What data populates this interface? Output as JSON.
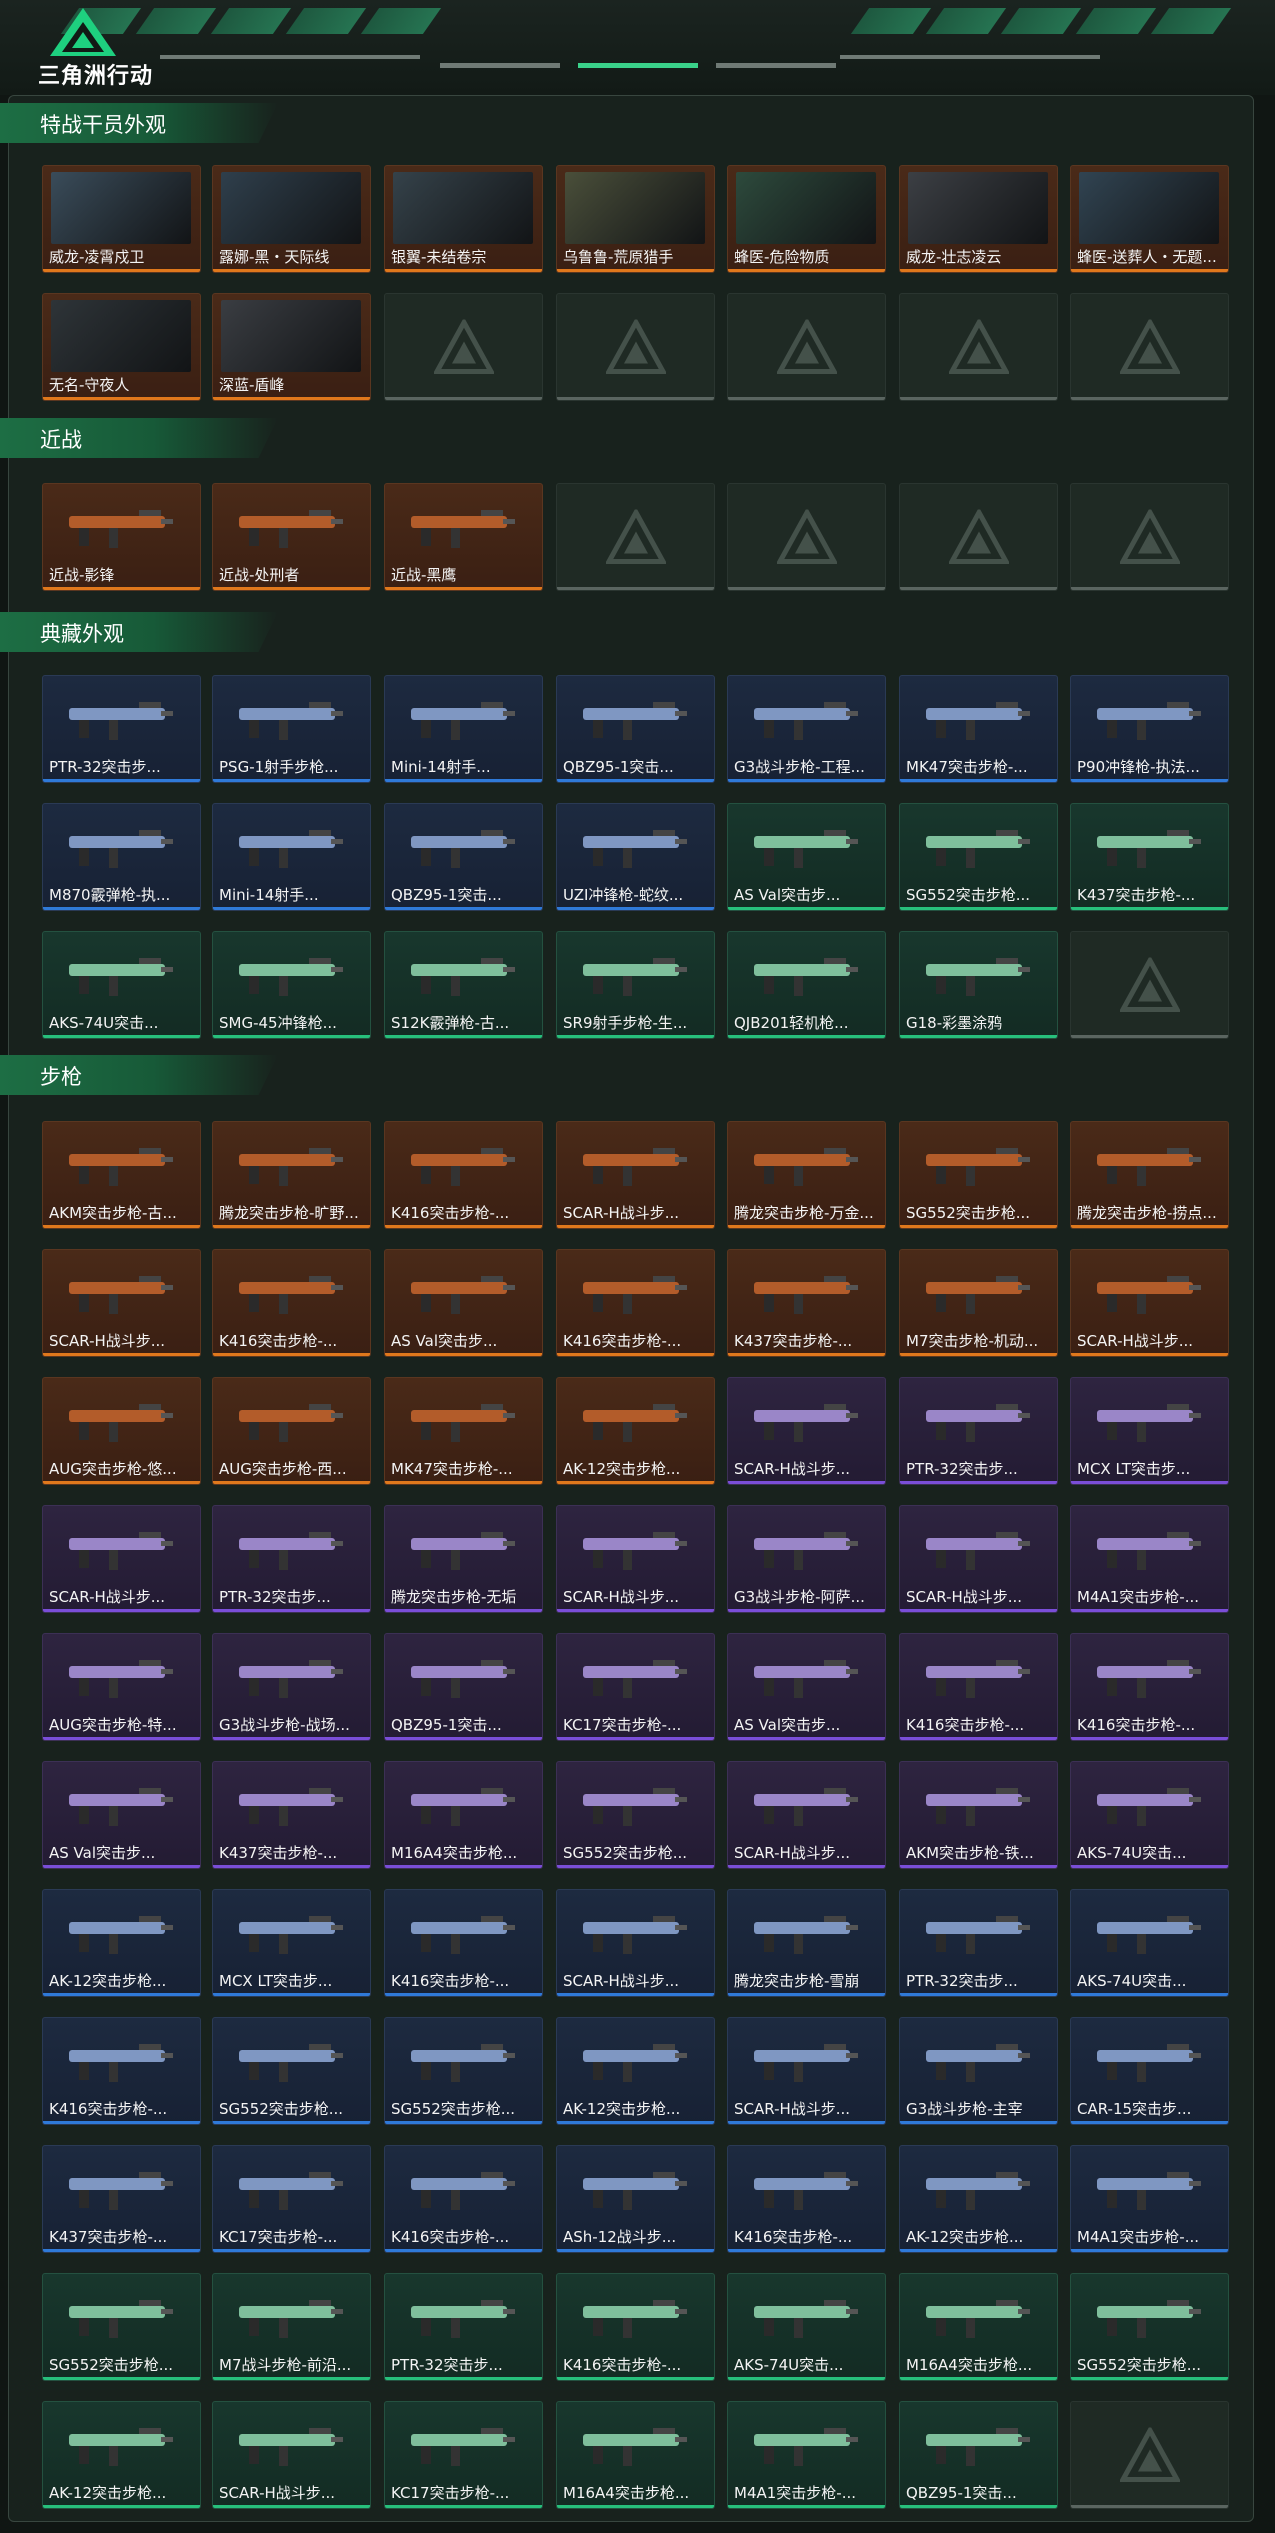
{
  "app": {
    "title": "三角洲行动"
  },
  "colors": {
    "legendary": "#e0781c",
    "epic": "#7a4ed8",
    "rare": "#2f7ad9",
    "uncommon": "#27c07c",
    "empty": "#5a6560"
  },
  "sections": [
    {
      "title": "特战干员外观",
      "items": [
        {
          "label": "威龙-凌霄戍卫",
          "rarity": "gold"
        },
        {
          "label": "露娜-黑・天际线",
          "rarity": "gold"
        },
        {
          "label": "银翼-未结卷宗",
          "rarity": "gold"
        },
        {
          "label": "乌鲁鲁-荒原猎手",
          "rarity": "gold"
        },
        {
          "label": "蜂医-危险物质",
          "rarity": "gold"
        },
        {
          "label": "威龙-壮志凌云",
          "rarity": "gold"
        },
        {
          "label": "蜂医-送葬人・无题...",
          "rarity": "gold"
        },
        {
          "label": "无名-守夜人",
          "rarity": "gold"
        },
        {
          "label": "深蓝-盾峰",
          "rarity": "gold"
        },
        {
          "label": "",
          "rarity": "empty"
        },
        {
          "label": "",
          "rarity": "empty"
        },
        {
          "label": "",
          "rarity": "empty"
        },
        {
          "label": "",
          "rarity": "empty"
        },
        {
          "label": "",
          "rarity": "empty"
        }
      ]
    },
    {
      "title": "近战",
      "items": [
        {
          "label": "近战-影锋",
          "rarity": "gold"
        },
        {
          "label": "近战-处刑者",
          "rarity": "gold"
        },
        {
          "label": "近战-黑鹰",
          "rarity": "gold"
        },
        {
          "label": "",
          "rarity": "empty"
        },
        {
          "label": "",
          "rarity": "empty"
        },
        {
          "label": "",
          "rarity": "empty"
        },
        {
          "label": "",
          "rarity": "empty"
        }
      ]
    },
    {
      "title": "典藏外观",
      "items": [
        {
          "label": "PTR-32突击步...",
          "rarity": "blue"
        },
        {
          "label": "PSG-1射手步枪...",
          "rarity": "blue"
        },
        {
          "label": "Mini-14射手...",
          "rarity": "blue"
        },
        {
          "label": "QBZ95-1突击...",
          "rarity": "blue"
        },
        {
          "label": "G3战斗步枪-工程...",
          "rarity": "blue"
        },
        {
          "label": "MK47突击步枪-...",
          "rarity": "blue"
        },
        {
          "label": "P90冲锋枪-执法...",
          "rarity": "blue"
        },
        {
          "label": "M870霰弹枪-执...",
          "rarity": "blue"
        },
        {
          "label": "Mini-14射手...",
          "rarity": "blue"
        },
        {
          "label": "QBZ95-1突击...",
          "rarity": "blue"
        },
        {
          "label": "UZI冲锋枪-蛇纹...",
          "rarity": "blue"
        },
        {
          "label": "AS Val突击步...",
          "rarity": "green"
        },
        {
          "label": "SG552突击步枪...",
          "rarity": "green"
        },
        {
          "label": "K437突击步枪-...",
          "rarity": "green"
        },
        {
          "label": "AKS-74U突击...",
          "rarity": "green"
        },
        {
          "label": "SMG-45冲锋枪...",
          "rarity": "green"
        },
        {
          "label": "S12K霰弹枪-古...",
          "rarity": "green"
        },
        {
          "label": "SR9射手步枪-生...",
          "rarity": "green"
        },
        {
          "label": "QJB201轻机枪...",
          "rarity": "green"
        },
        {
          "label": "G18-彩墨涂鸦",
          "rarity": "green"
        },
        {
          "label": "",
          "rarity": "empty"
        }
      ]
    },
    {
      "title": "步枪",
      "items": [
        {
          "label": "AKM突击步枪-古...",
          "rarity": "gold"
        },
        {
          "label": "腾龙突击步枪-旷野...",
          "rarity": "gold"
        },
        {
          "label": "K416突击步枪-...",
          "rarity": "gold"
        },
        {
          "label": "SCAR-H战斗步...",
          "rarity": "gold"
        },
        {
          "label": "腾龙突击步枪-万金...",
          "rarity": "gold"
        },
        {
          "label": "SG552突击步枪...",
          "rarity": "gold"
        },
        {
          "label": "腾龙突击步枪-捞点...",
          "rarity": "gold"
        },
        {
          "label": "SCAR-H战斗步...",
          "rarity": "gold"
        },
        {
          "label": "K416突击步枪-...",
          "rarity": "gold"
        },
        {
          "label": "AS Val突击步...",
          "rarity": "gold"
        },
        {
          "label": "K416突击步枪-...",
          "rarity": "gold"
        },
        {
          "label": "K437突击步枪-...",
          "rarity": "gold"
        },
        {
          "label": "M7突击步枪-机动...",
          "rarity": "gold"
        },
        {
          "label": "SCAR-H战斗步...",
          "rarity": "gold"
        },
        {
          "label": "AUG突击步枪-悠...",
          "rarity": "gold"
        },
        {
          "label": "AUG突击步枪-西...",
          "rarity": "gold"
        },
        {
          "label": "MK47突击步枪-...",
          "rarity": "gold"
        },
        {
          "label": "AK-12突击步枪...",
          "rarity": "gold"
        },
        {
          "label": "SCAR-H战斗步...",
          "rarity": "purple"
        },
        {
          "label": "PTR-32突击步...",
          "rarity": "purple"
        },
        {
          "label": "MCX LT突击步...",
          "rarity": "purple"
        },
        {
          "label": "SCAR-H战斗步...",
          "rarity": "purple"
        },
        {
          "label": "PTR-32突击步...",
          "rarity": "purple"
        },
        {
          "label": "腾龙突击步枪-无垢",
          "rarity": "purple"
        },
        {
          "label": "SCAR-H战斗步...",
          "rarity": "purple"
        },
        {
          "label": "G3战斗步枪-阿萨...",
          "rarity": "purple"
        },
        {
          "label": "SCAR-H战斗步...",
          "rarity": "purple"
        },
        {
          "label": "M4A1突击步枪-...",
          "rarity": "purple"
        },
        {
          "label": "AUG突击步枪-特...",
          "rarity": "purple"
        },
        {
          "label": "G3战斗步枪-战场...",
          "rarity": "purple"
        },
        {
          "label": "QBZ95-1突击...",
          "rarity": "purple"
        },
        {
          "label": "KC17突击步枪-...",
          "rarity": "purple"
        },
        {
          "label": "AS Val突击步...",
          "rarity": "purple"
        },
        {
          "label": "K416突击步枪-...",
          "rarity": "purple"
        },
        {
          "label": "K416突击步枪-...",
          "rarity": "purple"
        },
        {
          "label": "AS Val突击步...",
          "rarity": "purple"
        },
        {
          "label": "K437突击步枪-...",
          "rarity": "purple"
        },
        {
          "label": "M16A4突击步枪...",
          "rarity": "purple"
        },
        {
          "label": "SG552突击步枪...",
          "rarity": "purple"
        },
        {
          "label": "SCAR-H战斗步...",
          "rarity": "purple"
        },
        {
          "label": "AKM突击步枪-铁...",
          "rarity": "purple"
        },
        {
          "label": "AKS-74U突击...",
          "rarity": "purple"
        },
        {
          "label": "AK-12突击步枪...",
          "rarity": "blue"
        },
        {
          "label": "MCX LT突击步...",
          "rarity": "blue"
        },
        {
          "label": "K416突击步枪-...",
          "rarity": "blue"
        },
        {
          "label": "SCAR-H战斗步...",
          "rarity": "blue"
        },
        {
          "label": "腾龙突击步枪-雪崩",
          "rarity": "blue"
        },
        {
          "label": "PTR-32突击步...",
          "rarity": "blue"
        },
        {
          "label": "AKS-74U突击...",
          "rarity": "blue"
        },
        {
          "label": "K416突击步枪-...",
          "rarity": "blue"
        },
        {
          "label": "SG552突击步枪...",
          "rarity": "blue"
        },
        {
          "label": "SG552突击步枪...",
          "rarity": "blue"
        },
        {
          "label": "AK-12突击步枪...",
          "rarity": "blue"
        },
        {
          "label": "SCAR-H战斗步...",
          "rarity": "blue"
        },
        {
          "label": "G3战斗步枪-主宰",
          "rarity": "blue"
        },
        {
          "label": "CAR-15突击步...",
          "rarity": "blue"
        },
        {
          "label": "K437突击步枪-...",
          "rarity": "blue"
        },
        {
          "label": "KC17突击步枪-...",
          "rarity": "blue"
        },
        {
          "label": "K416突击步枪-...",
          "rarity": "blue"
        },
        {
          "label": "ASh-12战斗步...",
          "rarity": "blue"
        },
        {
          "label": "K416突击步枪-...",
          "rarity": "blue"
        },
        {
          "label": "AK-12突击步枪...",
          "rarity": "blue"
        },
        {
          "label": "M4A1突击步枪-...",
          "rarity": "blue"
        },
        {
          "label": "SG552突击步枪...",
          "rarity": "green"
        },
        {
          "label": "M7战斗步枪-前沿...",
          "rarity": "green"
        },
        {
          "label": "PTR-32突击步...",
          "rarity": "green"
        },
        {
          "label": "K416突击步枪-...",
          "rarity": "green"
        },
        {
          "label": "AKS-74U突击...",
          "rarity": "green"
        },
        {
          "label": "M16A4突击步枪...",
          "rarity": "green"
        },
        {
          "label": "SG552突击步枪...",
          "rarity": "green"
        },
        {
          "label": "AK-12突击步枪...",
          "rarity": "green"
        },
        {
          "label": "SCAR-H战斗步...",
          "rarity": "green"
        },
        {
          "label": "KC17突击步枪-...",
          "rarity": "green"
        },
        {
          "label": "M16A4突击步枪...",
          "rarity": "green"
        },
        {
          "label": "M4A1突击步枪-...",
          "rarity": "green"
        },
        {
          "label": "QBZ95-1突击...",
          "rarity": "green"
        },
        {
          "label": "",
          "rarity": "empty"
        }
      ]
    }
  ]
}
